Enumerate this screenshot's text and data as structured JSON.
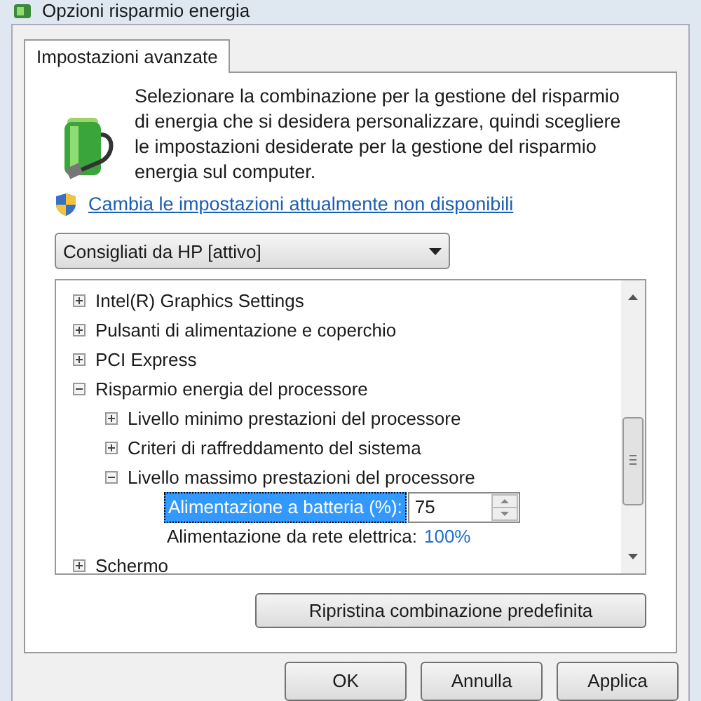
{
  "window": {
    "title": "Opzioni risparmio energia"
  },
  "tabs": [
    {
      "label": "Impostazioni avanzate",
      "selected": true
    }
  ],
  "description": "Selezionare la combinazione per la gestione del risparmio di energia che si desidera personalizzare, quindi scegliere le impostazioni desiderate per la gestione del risparmio energia sul computer.",
  "link": "Cambia le impostazioni attualmente non disponibili",
  "plan_dropdown": {
    "value": "Consigliati da HP [attivo]"
  },
  "tree": [
    {
      "label": "Intel(R) Graphics Settings",
      "expanded": false
    },
    {
      "label": "Pulsanti di alimentazione e coperchio",
      "expanded": false
    },
    {
      "label": "PCI Express",
      "expanded": false
    },
    {
      "label": "Risparmio energia del processore",
      "expanded": true,
      "children": [
        {
          "label": "Livello minimo prestazioni del processore",
          "expanded": false
        },
        {
          "label": "Criteri di raffreddamento del sistema",
          "expanded": false
        },
        {
          "label": "Livello massimo prestazioni del processore",
          "expanded": true,
          "children": [
            {
              "kind": "spinner",
              "label": "Alimentazione a batteria (%):",
              "value": "75",
              "selected": true
            },
            {
              "kind": "value",
              "label": "Alimentazione da rete elettrica:",
              "value": "100%",
              "selected": false
            }
          ]
        }
      ]
    },
    {
      "label": "Schermo",
      "expanded": false
    }
  ],
  "reset_button": "Ripristina combinazione predefinita",
  "buttons": [
    "OK",
    "Annulla",
    "Applica"
  ]
}
